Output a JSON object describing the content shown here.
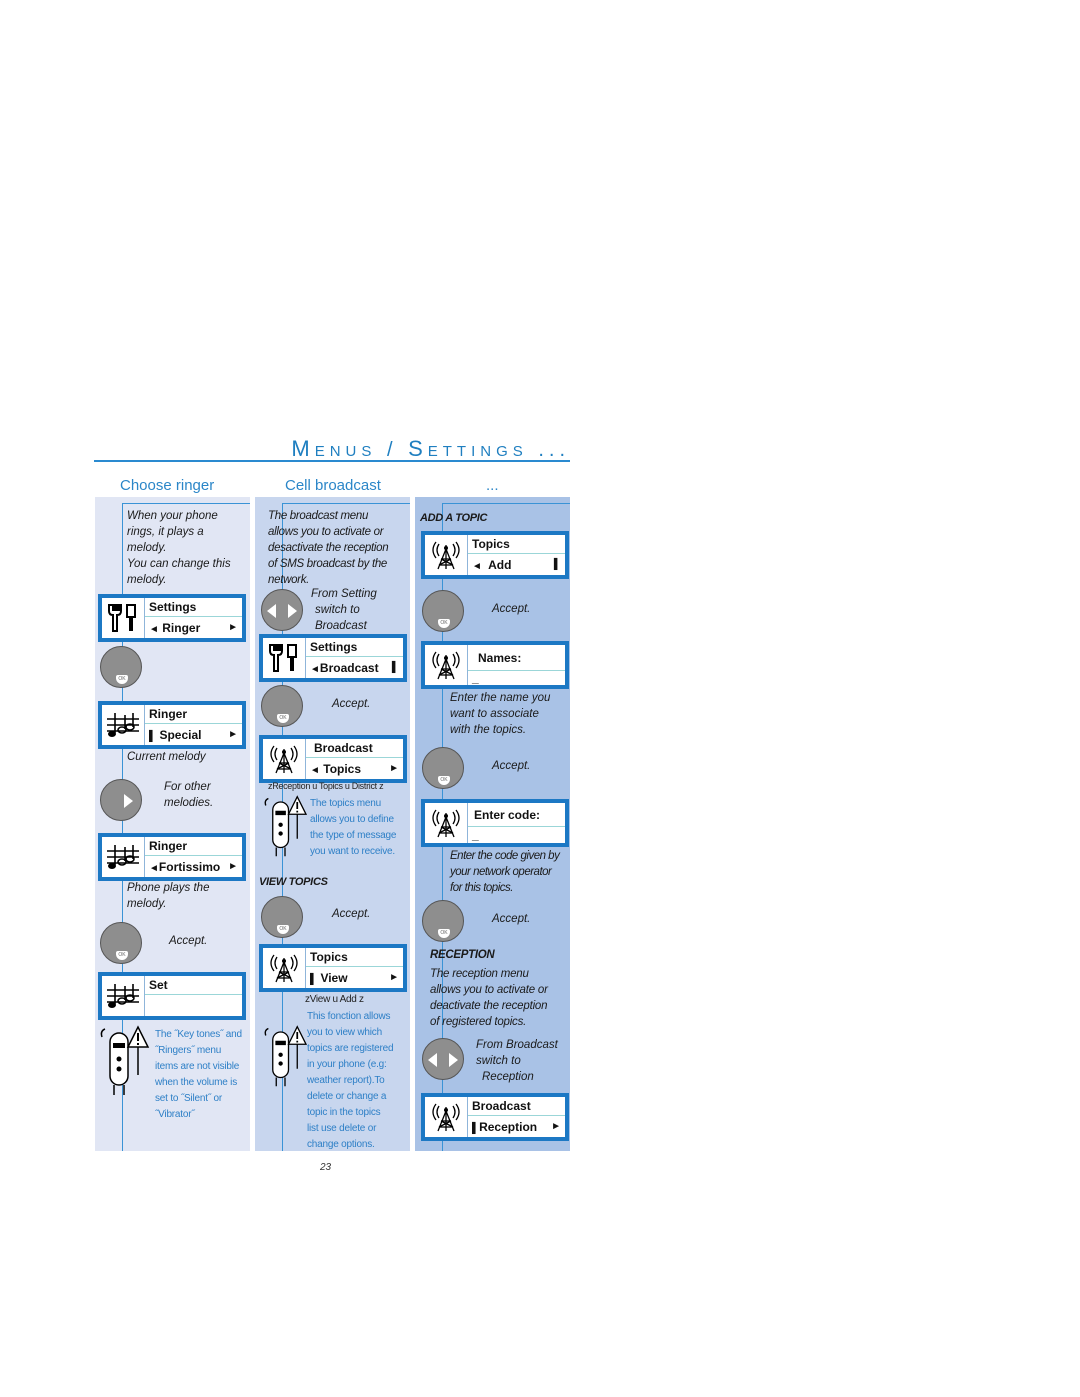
{
  "header": {
    "title_parts": [
      {
        "cap": "M",
        "rest": "ENUS"
      },
      {
        "cap": "/",
        "rest": ""
      },
      {
        "cap": "S",
        "rest": "ETTINGS"
      },
      {
        "cap": "...",
        "rest": ""
      }
    ],
    "title": "Menus / Settings ..."
  },
  "colors": {
    "accent": "#1c78c4",
    "heading": "#2b86c8",
    "panel1": "#e1e6f4",
    "panel2": "#c8d6ee",
    "panel3": "#a9c2e6",
    "button": "#8e8e8e"
  },
  "columns": [
    {
      "heading": "Choose ringer",
      "intro": [
        "When your phone",
        "rings, it plays a",
        "melody.",
        "You can change this",
        "melody."
      ],
      "screen1": {
        "icon": "settings-tools-icon",
        "line1": "Settings",
        "line2": "Ringer",
        "left": "◄",
        "right": "►"
      },
      "screen2": {
        "icon": "music-notes-icon",
        "line1": "Ringer",
        "line2": "Special",
        "left": "▌",
        "right": "►"
      },
      "current_melody": "Current melody",
      "other_melodies": [
        "For other",
        "melodies."
      ],
      "screen3": {
        "icon": "music-notes-icon",
        "line1": "Ringer",
        "line2": "Fortissimo",
        "left": "◄",
        "right": "►"
      },
      "plays": [
        "Phone plays the",
        "melody."
      ],
      "accept": "Accept.",
      "screen4": {
        "icon": "music-notes-icon",
        "line1": "Set",
        "line2": ""
      },
      "note": [
        "The ˝Key tones˝ and",
        "˝Ringers˝ menu",
        "items are not visible",
        "when the volume is",
        "set to ˝Silent˝ or",
        "˝Vibrator˝"
      ]
    },
    {
      "heading": "Cell broadcast",
      "intro": [
        "The broadcast menu",
        "allows you to activate or",
        "desactivate the reception",
        "of SMS broadcast by the",
        "network."
      ],
      "from": [
        "From  Setting",
        "switch to",
        "Broadcast"
      ],
      "screen1": {
        "icon": "settings-tools-icon",
        "line1": "Settings",
        "line2": "Broadcast",
        "left": "◄",
        "right": "▌"
      },
      "accept1": "Accept.",
      "screen2": {
        "icon": "antenna-icon",
        "line1": "Broadcast",
        "line2": "Topics",
        "left": "◄",
        "right": "►"
      },
      "submenu": "zReception    u Topics   u District        z",
      "note1": [
        "The topics menu",
        "allows you to define",
        "the type of message",
        "you want to receive."
      ],
      "view_topics": "VIEW TOPICS",
      "accept2": "Accept.",
      "screen3": {
        "icon": "antenna-icon",
        "line1": "Topics",
        "line2": "View",
        "left": "▌",
        "right": "►"
      },
      "submenu2": "zView u Add z",
      "note2": [
        "This fonction allows",
        "you to view which",
        "topics are registered",
        "in your phone (e.g:",
        "weather report).To",
        "delete or change a",
        "topic in the topics",
        "list use delete or",
        "change options."
      ]
    },
    {
      "heading": "...",
      "add_topic": "ADD A TOPIC",
      "screen1": {
        "icon": "antenna-icon",
        "line1": "Topics",
        "line2": "Add",
        "left": "◄",
        "right": "▌"
      },
      "accept1": "Accept.",
      "screen2": {
        "icon": "antenna-icon",
        "line1": "Names:",
        "line2": "_"
      },
      "enter_name": [
        "Enter the name you",
        "want to associate",
        "with the topics."
      ],
      "accept2": "Accept.",
      "screen3": {
        "icon": "antenna-icon",
        "line1": "Enter code:",
        "line2": "_"
      },
      "enter_code": [
        "Enter the code given by",
        "your network operator",
        "for  this topics."
      ],
      "accept3": "Accept.",
      "reception": "RECEPTION",
      "reception_text": [
        "The reception menu",
        "allows you to activate or",
        "deactivate the reception",
        "of registered topics."
      ],
      "from": [
        "From Broadcast",
        "switch to",
        "Reception"
      ],
      "screen4": {
        "icon": "antenna-icon",
        "line1": "Broadcast",
        "line2": "Reception",
        "left": "▌",
        "right": "►"
      }
    }
  ],
  "page_number": "23"
}
